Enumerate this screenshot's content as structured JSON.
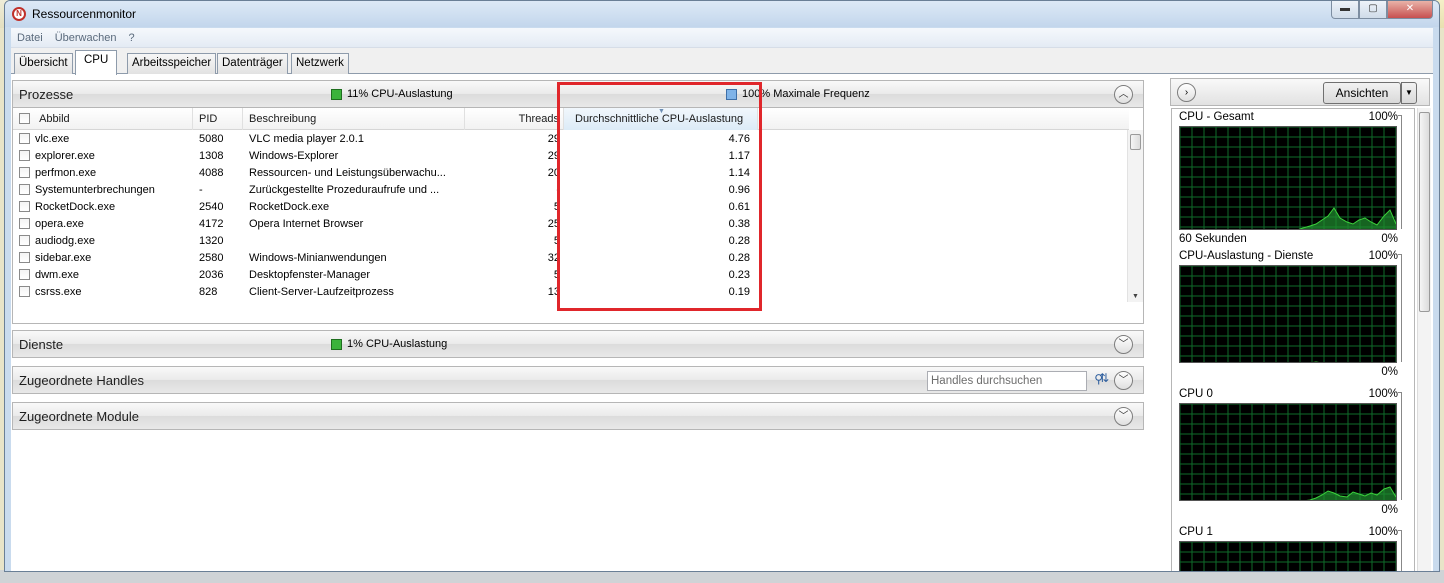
{
  "window": {
    "title": "Ressourcenmonitor",
    "minimize_glyph": "▬",
    "maximize_glyph": "▢",
    "close_glyph": "✕"
  },
  "menu": [
    "Datei",
    "Überwachen",
    "?"
  ],
  "tabs": [
    "Übersicht",
    "CPU",
    "Arbeitsspeicher",
    "Datenträger",
    "Netzwerk"
  ],
  "active_tab": "CPU",
  "processes": {
    "title": "Prozesse",
    "cpu_usage": "11% CPU-Auslastung",
    "max_frequency": "100% Maximale Frequenz",
    "columns": {
      "image": "Abbild",
      "pid": "PID",
      "description": "Beschreibung",
      "threads": "Threads",
      "avg_cpu": "Durchschnittliche CPU-Auslastung"
    },
    "rows": [
      {
        "image": "vlc.exe",
        "pid": "5080",
        "description": "VLC media player 2.0.1",
        "threads": "29",
        "avg_cpu": "4.76"
      },
      {
        "image": "explorer.exe",
        "pid": "1308",
        "description": "Windows-Explorer",
        "threads": "29",
        "avg_cpu": "1.17"
      },
      {
        "image": "perfmon.exe",
        "pid": "4088",
        "description": "Ressourcen- und Leistungsüberwachu...",
        "threads": "20",
        "avg_cpu": "1.14"
      },
      {
        "image": "Systemunterbrechungen",
        "pid": "-",
        "description": "Zurückgestellte Prozeduraufrufe und ...",
        "threads": "-",
        "avg_cpu": "0.96"
      },
      {
        "image": "RocketDock.exe",
        "pid": "2540",
        "description": "RocketDock.exe",
        "threads": "5",
        "avg_cpu": "0.61"
      },
      {
        "image": "opera.exe",
        "pid": "4172",
        "description": "Opera Internet Browser",
        "threads": "25",
        "avg_cpu": "0.38"
      },
      {
        "image": "audiodg.exe",
        "pid": "1320",
        "description": "",
        "threads": "5",
        "avg_cpu": "0.28"
      },
      {
        "image": "sidebar.exe",
        "pid": "2580",
        "description": "Windows-Minianwendungen",
        "threads": "32",
        "avg_cpu": "0.28"
      },
      {
        "image": "dwm.exe",
        "pid": "2036",
        "description": "Desktopfenster-Manager",
        "threads": "5",
        "avg_cpu": "0.23"
      },
      {
        "image": "csrss.exe",
        "pid": "828",
        "description": "Client-Server-Laufzeitprozess",
        "threads": "13",
        "avg_cpu": "0.19"
      }
    ]
  },
  "services": {
    "title": "Dienste",
    "cpu_usage": "1% CPU-Auslastung"
  },
  "handles": {
    "title": "Zugeordnete Handles",
    "search_placeholder": "Handles durchsuchen"
  },
  "modules": {
    "title": "Zugeordnete Module"
  },
  "right_panel": {
    "views_button": "Ansichten",
    "graphs": [
      {
        "label": "CPU - Gesamt",
        "max": "100%",
        "min": "0%",
        "footer": "60 Sekunden"
      },
      {
        "label": "CPU-Auslastung - Dienste",
        "max": "100%",
        "min": "0%"
      },
      {
        "label": "CPU 0",
        "max": "100%",
        "min": "0%"
      },
      {
        "label": "CPU 1",
        "max": "100%"
      }
    ]
  },
  "colors": {
    "highlight_box": "#e0262b",
    "graph_line": "#3bd13b",
    "graph_grid": "#0f6b2a"
  }
}
